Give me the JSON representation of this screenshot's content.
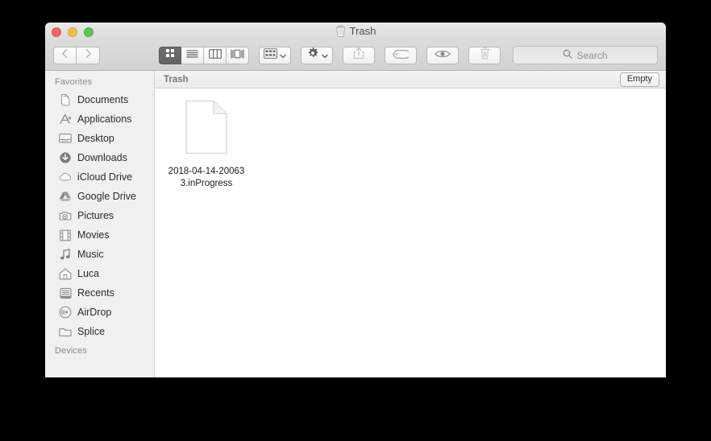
{
  "window": {
    "title": "Trash",
    "title_icon": "trash-icon",
    "traffic_lights": [
      {
        "name": "close-button",
        "color": "#ec6a5f"
      },
      {
        "name": "minimize-button",
        "color": "#f5bd4f"
      },
      {
        "name": "maximize-button",
        "color": "#61c554"
      }
    ]
  },
  "toolbar": {
    "back_icon": "chevron-left-icon",
    "forward_icon": "chevron-right-icon",
    "view_modes": [
      {
        "name": "icon-view",
        "icon": "grid-icon",
        "selected": true
      },
      {
        "name": "list-view",
        "icon": "list-icon",
        "selected": false
      },
      {
        "name": "column-view",
        "icon": "columns-icon",
        "selected": false
      },
      {
        "name": "gallery-view",
        "icon": "coverflow-icon",
        "selected": false
      }
    ],
    "arrange_icon": "arrange-grid-icon",
    "arrange_chevron": "chevron-down-icon",
    "action_icon": "gear-icon",
    "action_chevron": "chevron-down-icon",
    "share_icon": "share-icon",
    "tag_icon": "tag-icon",
    "quicklook_icon": "eye-icon",
    "delete_icon": "trash-icon"
  },
  "search": {
    "placeholder": "Search",
    "value": "",
    "icon": "search-icon"
  },
  "sidebar": {
    "sections": [
      {
        "header": "Favorites",
        "items": [
          {
            "label": "Documents",
            "icon": "documents-icon"
          },
          {
            "label": "Applications",
            "icon": "applications-icon"
          },
          {
            "label": "Desktop",
            "icon": "desktop-icon"
          },
          {
            "label": "Downloads",
            "icon": "downloads-icon"
          },
          {
            "label": "iCloud Drive",
            "icon": "icloud-icon"
          },
          {
            "label": "Google Drive",
            "icon": "google-drive-icon"
          },
          {
            "label": "Pictures",
            "icon": "pictures-icon"
          },
          {
            "label": "Movies",
            "icon": "movies-icon"
          },
          {
            "label": "Music",
            "icon": "music-icon"
          },
          {
            "label": "Luca",
            "icon": "home-icon"
          },
          {
            "label": "Recents",
            "icon": "recents-icon"
          },
          {
            "label": "AirDrop",
            "icon": "airdrop-icon"
          },
          {
            "label": "Splice",
            "icon": "folder-icon"
          }
        ]
      },
      {
        "header": "Devices",
        "items": []
      }
    ]
  },
  "pathbar": {
    "label": "Trash",
    "empty_button": "Empty"
  },
  "files": [
    {
      "name": "2018-04-14-200633.inProgress",
      "icon": "blank-document-icon"
    }
  ]
}
